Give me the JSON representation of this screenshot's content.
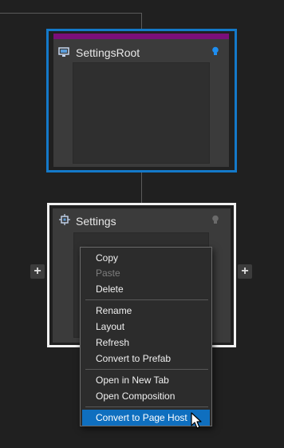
{
  "colors": {
    "background": "#202020",
    "selected_outline": "#1479c9",
    "root_header_bar": "#7a0f7a",
    "menu_highlight": "#0f6fbf"
  },
  "nodes": {
    "root": {
      "title": "SettingsRoot",
      "icon": "monitor-icon",
      "indicator": "lightbulb-icon",
      "selected": true
    },
    "settings": {
      "title": "Settings",
      "icon": "component-icon",
      "indicator": "lightbulb-icon"
    }
  },
  "buttons": {
    "add_left": "+",
    "add_right": "+"
  },
  "context_menu": {
    "groups": [
      [
        {
          "label": "Copy",
          "enabled": true
        },
        {
          "label": "Paste",
          "enabled": false
        },
        {
          "label": "Delete",
          "enabled": true
        }
      ],
      [
        {
          "label": "Rename",
          "enabled": true
        },
        {
          "label": "Layout",
          "enabled": true
        },
        {
          "label": "Refresh",
          "enabled": true
        },
        {
          "label": "Convert to Prefab",
          "enabled": true
        }
      ],
      [
        {
          "label": "Open in New Tab",
          "enabled": true
        },
        {
          "label": "Open Composition",
          "enabled": true
        }
      ],
      [
        {
          "label": "Convert to Page Host",
          "enabled": true,
          "highlighted": true
        }
      ]
    ]
  }
}
